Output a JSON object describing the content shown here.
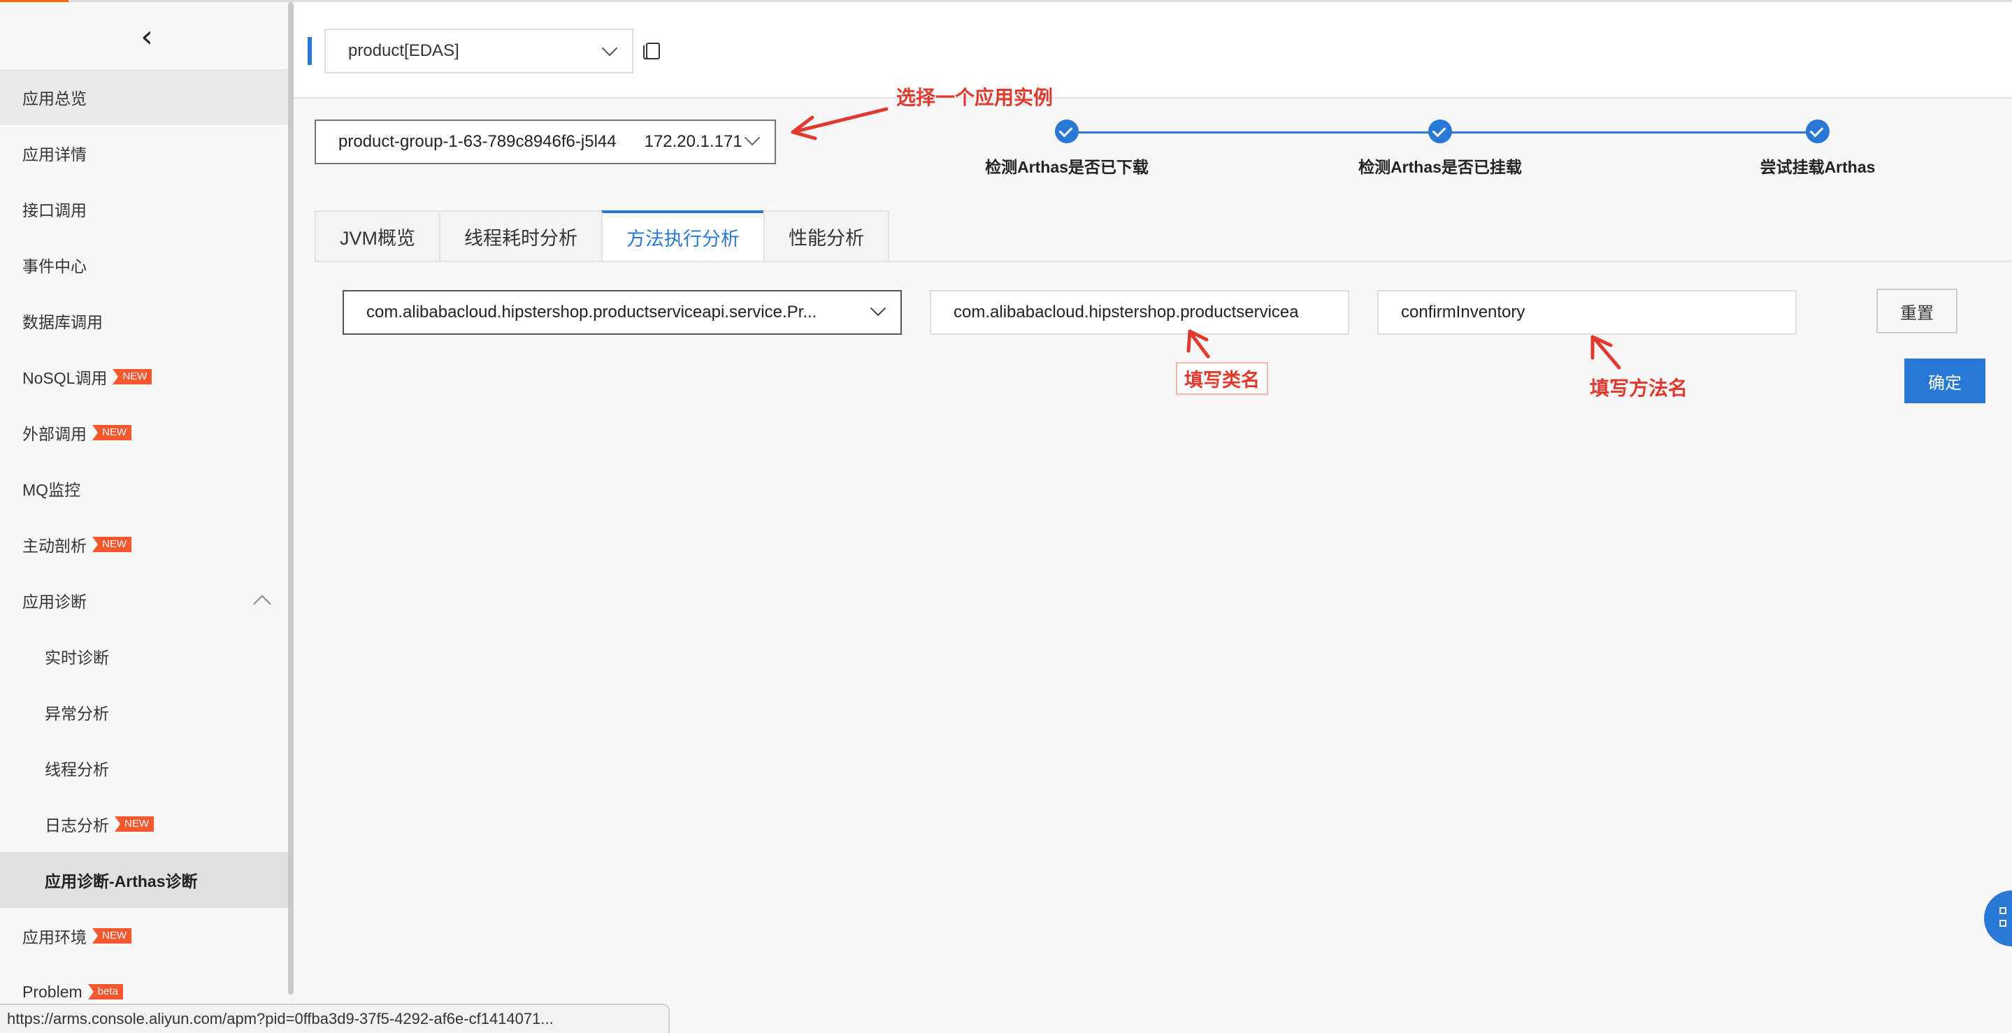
{
  "sidebar": {
    "items": [
      {
        "label": "应用总览",
        "badge": "",
        "level": 1,
        "state": "active"
      },
      {
        "label": "应用详情",
        "badge": "",
        "level": 1,
        "state": ""
      },
      {
        "label": "接口调用",
        "badge": "",
        "level": 1,
        "state": ""
      },
      {
        "label": "事件中心",
        "badge": "",
        "level": 1,
        "state": ""
      },
      {
        "label": "数据库调用",
        "badge": "",
        "level": 1,
        "state": ""
      },
      {
        "label": "NoSQL调用",
        "badge": "NEW",
        "level": 1,
        "state": ""
      },
      {
        "label": "外部调用",
        "badge": "NEW",
        "level": 1,
        "state": ""
      },
      {
        "label": "MQ监控",
        "badge": "",
        "level": 1,
        "state": ""
      },
      {
        "label": "主动剖析",
        "badge": "NEW",
        "level": 1,
        "state": ""
      },
      {
        "label": "应用诊断",
        "badge": "",
        "level": 1,
        "state": "expanded"
      },
      {
        "label": "实时诊断",
        "badge": "",
        "level": 2,
        "state": ""
      },
      {
        "label": "异常分析",
        "badge": "",
        "level": 2,
        "state": ""
      },
      {
        "label": "线程分析",
        "badge": "",
        "level": 2,
        "state": ""
      },
      {
        "label": "日志分析",
        "badge": "NEW",
        "level": 2,
        "state": ""
      },
      {
        "label": "应用诊断-Arthas诊断",
        "badge": "",
        "level": 2,
        "state": "current"
      },
      {
        "label": "应用环境",
        "badge": "NEW",
        "level": 1,
        "state": ""
      },
      {
        "label": "Problem",
        "badge": "beta",
        "level": 1,
        "state": ""
      }
    ]
  },
  "header": {
    "app_select": "product[EDAS]"
  },
  "instance": {
    "name": "product-group-1-63-789c8946f6-j5l44",
    "ip": "172.20.1.171"
  },
  "steps": [
    {
      "label": "检测Arthas是否已下载",
      "done": true
    },
    {
      "label": "检测Arthas是否已挂载",
      "done": true
    },
    {
      "label": "尝试挂载Arthas",
      "done": true
    }
  ],
  "tabs": [
    {
      "label": "JVM概览",
      "active": false
    },
    {
      "label": "线程耗时分析",
      "active": false
    },
    {
      "label": "方法执行分析",
      "active": true
    },
    {
      "label": "性能分析",
      "active": false
    }
  ],
  "form": {
    "interface_select": "com.alibabacloud.hipstershop.productserviceapi.service.Pr...",
    "class_value": "com.alibabacloud.hipstershop.productservicea",
    "method_value": "confirmInventory",
    "reset_label": "重置",
    "confirm_label": "确定"
  },
  "annotations": {
    "select_instance": "选择一个应用实例",
    "fill_class": "填写类名",
    "fill_method": "填写方法名"
  },
  "status_url": "https://arms.console.aliyun.com/apm?pid=0ffba3d9-37f5-4292-af6e-cf1414071...",
  "colors": {
    "accent": "#2a78d6",
    "annotation": "#e03a2f",
    "badge": "#f5572e",
    "brand_top": "#ff6a00"
  }
}
